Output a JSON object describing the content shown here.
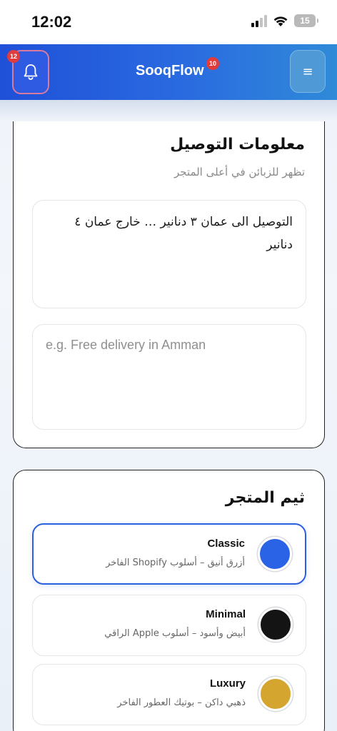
{
  "status_bar": {
    "time": "12:02",
    "battery": "15"
  },
  "header": {
    "brand": "SooqFlow",
    "brand_badge": "10",
    "notification_count": "12",
    "menu_icon": "≡"
  },
  "delivery_card": {
    "title": "معلومات التوصيل",
    "subtitle": "تظهر للزبائن في أعلى المتجر",
    "arabic_field_value": "التوصيل الى عمان ٣ دنانير  … خارج عمان ٤ دنانير",
    "english_field_placeholder": "e.g. Free delivery in Amman"
  },
  "theme_card": {
    "title": "ثيم المتجر",
    "options": [
      {
        "name": "Classic",
        "description": "أزرق أنيق – أسلوب Shopify الفاخر",
        "color": "#2b63e6",
        "selected": true
      },
      {
        "name": "Minimal",
        "description": "أبيض وأسود – أسلوب Apple الراقي",
        "color": "#141414",
        "selected": false
      },
      {
        "name": "Luxury",
        "description": "ذهبي داكن – بوتيك العطور الفاخر",
        "color": "#d4a52f",
        "selected": false
      }
    ]
  },
  "colors": {
    "header_start": "#1f50d8",
    "header_end": "#2f8ad8",
    "accent": "#2b5fe0",
    "badge": "#e23b3b"
  }
}
